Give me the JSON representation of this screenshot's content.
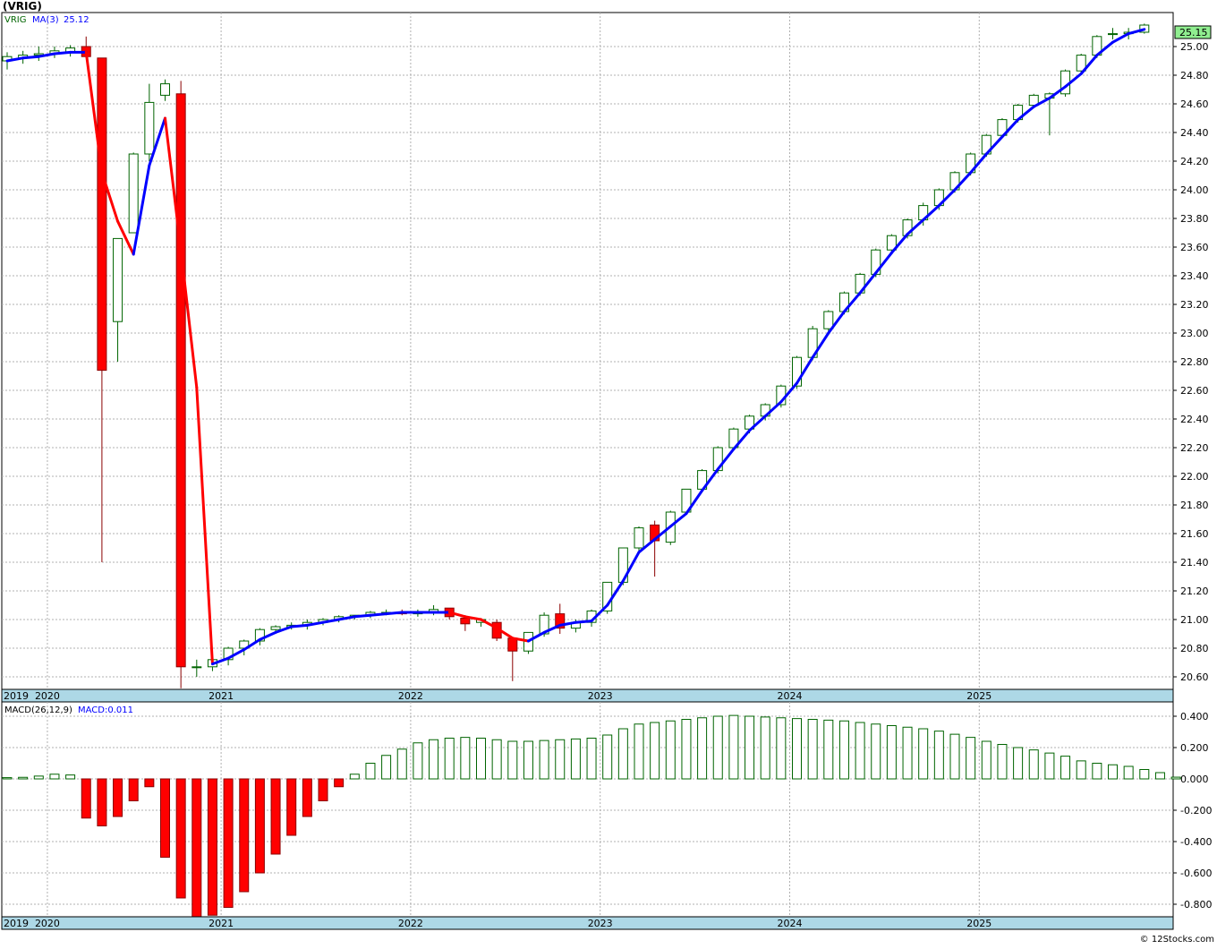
{
  "header": {
    "title": "(VRIG)",
    "price_legend_ticker": "VRIG",
    "price_legend_ma": "MA(3)",
    "price_legend_ma_value": "25.12",
    "last_price_badge": "25.15",
    "macd_legend_name": "MACD(26,12,9)",
    "macd_legend_value": "MACD:0.011",
    "watermark": "© 12Stocks.com"
  },
  "colors": {
    "up_body": "#ffffff",
    "up_border": "#006400",
    "down_body": "#ff0000",
    "down_border": "#8b0000",
    "ma_rising": "#0000ff",
    "ma_falling": "#ff0000",
    "macd_pos": "#006400",
    "macd_neg": "#ff0000",
    "grid": "#b0b0b0",
    "axis_band": "#add8e6",
    "badge": "#90ee90"
  },
  "chart_data": [
    {
      "type": "candlestick",
      "title": "(VRIG)",
      "interval": "monthly",
      "x_labels": [
        "2019",
        "2020",
        "2021",
        "2022",
        "2023",
        "2024",
        "2025"
      ],
      "y_ticks": [
        "25.00",
        "24.80",
        "24.60",
        "24.40",
        "24.20",
        "24.00",
        "23.80",
        "23.60",
        "23.40",
        "23.20",
        "23.00",
        "22.80",
        "22.60",
        "22.40",
        "22.20",
        "22.00",
        "21.80",
        "21.60",
        "21.40",
        "21.20",
        "21.00",
        "20.80",
        "20.60"
      ],
      "ylim": [
        20.5,
        25.2
      ],
      "grid": true,
      "series": [
        {
          "name": "VRIG",
          "ohlc": [
            [
              24.9,
              24.96,
              24.84,
              24.93
            ],
            [
              24.92,
              24.97,
              24.88,
              24.94
            ],
            [
              24.94,
              25.0,
              24.9,
              24.95
            ],
            [
              24.95,
              25.0,
              24.92,
              24.97
            ],
            [
              24.96,
              25.01,
              24.93,
              24.99
            ],
            [
              25.0,
              25.07,
              24.92,
              24.93
            ],
            [
              24.92,
              24.92,
              21.4,
              22.74
            ],
            [
              23.08,
              23.66,
              22.8,
              23.66
            ],
            [
              23.7,
              24.26,
              23.7,
              24.25
            ],
            [
              24.25,
              24.74,
              24.2,
              24.61
            ],
            [
              24.66,
              24.77,
              24.62,
              24.74
            ],
            [
              24.67,
              24.76,
              20.52,
              20.67
            ],
            [
              20.67,
              20.72,
              20.6,
              20.67
            ],
            [
              20.67,
              20.72,
              20.64,
              20.72
            ],
            [
              20.72,
              20.81,
              20.68,
              20.8
            ],
            [
              20.8,
              20.86,
              20.75,
              20.85
            ],
            [
              20.85,
              20.94,
              20.82,
              20.93
            ],
            [
              20.93,
              20.96,
              20.91,
              20.95
            ],
            [
              20.95,
              20.98,
              20.93,
              20.96
            ],
            [
              20.96,
              21.0,
              20.93,
              20.98
            ],
            [
              20.98,
              21.01,
              20.96,
              21.0
            ],
            [
              21.0,
              21.03,
              20.98,
              21.02
            ],
            [
              21.02,
              21.03,
              21.0,
              21.03
            ],
            [
              21.03,
              21.06,
              21.01,
              21.05
            ],
            [
              21.05,
              21.07,
              21.03,
              21.05
            ],
            [
              21.05,
              21.07,
              21.03,
              21.04
            ],
            [
              21.04,
              21.07,
              21.02,
              21.05
            ],
            [
              21.05,
              21.1,
              21.03,
              21.07
            ],
            [
              21.08,
              21.08,
              21.0,
              21.02
            ],
            [
              21.01,
              21.03,
              20.92,
              20.97
            ],
            [
              20.98,
              21.01,
              20.95,
              21.0
            ],
            [
              20.98,
              21.0,
              20.85,
              20.87
            ],
            [
              20.87,
              20.88,
              20.57,
              20.78
            ],
            [
              20.78,
              20.89,
              20.76,
              20.91
            ],
            [
              20.9,
              21.05,
              20.88,
              21.03
            ],
            [
              21.04,
              21.11,
              20.9,
              20.94
            ],
            [
              20.94,
              21.0,
              20.91,
              20.98
            ],
            [
              20.98,
              21.07,
              20.95,
              21.06
            ],
            [
              21.06,
              21.26,
              21.04,
              21.26
            ],
            [
              21.26,
              21.5,
              21.24,
              21.5
            ],
            [
              21.5,
              21.65,
              21.47,
              21.64
            ],
            [
              21.66,
              21.69,
              21.3,
              21.55
            ],
            [
              21.54,
              21.76,
              21.52,
              21.75
            ],
            [
              21.75,
              21.91,
              21.73,
              21.91
            ],
            [
              21.91,
              22.05,
              21.89,
              22.04
            ],
            [
              22.04,
              22.21,
              22.02,
              22.2
            ],
            [
              22.2,
              22.34,
              22.18,
              22.33
            ],
            [
              22.33,
              22.43,
              22.3,
              22.42
            ],
            [
              22.42,
              22.51,
              22.39,
              22.5
            ],
            [
              22.5,
              22.64,
              22.48,
              22.63
            ],
            [
              22.63,
              22.84,
              22.61,
              22.83
            ],
            [
              22.83,
              23.05,
              22.81,
              23.03
            ],
            [
              23.03,
              23.16,
              23.01,
              23.15
            ],
            [
              23.15,
              23.29,
              23.13,
              23.28
            ],
            [
              23.28,
              23.42,
              23.26,
              23.41
            ],
            [
              23.41,
              23.59,
              23.39,
              23.58
            ],
            [
              23.58,
              23.69,
              23.56,
              23.68
            ],
            [
              23.68,
              23.8,
              23.66,
              23.79
            ],
            [
              23.79,
              23.91,
              23.75,
              23.89
            ],
            [
              23.89,
              24.01,
              23.86,
              24.0
            ],
            [
              24.0,
              24.13,
              23.98,
              24.12
            ],
            [
              24.12,
              24.26,
              24.1,
              24.25
            ],
            [
              24.25,
              24.39,
              24.23,
              24.38
            ],
            [
              24.38,
              24.5,
              24.36,
              24.49
            ],
            [
              24.49,
              24.6,
              24.47,
              24.59
            ],
            [
              24.59,
              24.67,
              24.57,
              24.66
            ],
            [
              24.64,
              24.68,
              24.38,
              24.67
            ],
            [
              24.67,
              24.84,
              24.65,
              24.83
            ],
            [
              24.83,
              24.95,
              24.81,
              24.94
            ],
            [
              24.94,
              25.08,
              24.92,
              25.07
            ],
            [
              25.09,
              25.13,
              25.05,
              25.09
            ],
            [
              25.09,
              25.13,
              25.05,
              25.1
            ],
            [
              25.1,
              25.16,
              25.09,
              25.15
            ]
          ]
        },
        {
          "name": "MA(3)",
          "values": [
            24.9,
            24.92,
            24.93,
            24.95,
            24.96,
            24.96,
            24.12,
            23.78,
            23.55,
            24.17,
            24.5,
            23.58,
            22.62,
            20.69,
            20.73,
            20.79,
            20.86,
            20.91,
            20.95,
            20.96,
            20.98,
            21.0,
            21.02,
            21.03,
            21.04,
            21.05,
            21.05,
            21.05,
            21.05,
            21.02,
            21.0,
            20.94,
            20.87,
            20.85,
            20.91,
            20.96,
            20.98,
            20.99,
            21.1,
            21.27,
            21.47,
            21.56,
            21.65,
            21.74,
            21.9,
            22.05,
            22.19,
            22.32,
            22.42,
            22.52,
            22.65,
            22.83,
            23.0,
            23.15,
            23.28,
            23.42,
            23.56,
            23.69,
            23.79,
            23.89,
            24.0,
            24.12,
            24.25,
            24.37,
            24.49,
            24.58,
            24.64,
            24.72,
            24.81,
            24.94,
            25.03,
            25.09,
            25.12
          ]
        }
      ]
    },
    {
      "type": "bar",
      "title": "MACD(26,12,9)",
      "x_labels": [
        "2019",
        "2020",
        "2021",
        "2022",
        "2023",
        "2024",
        "2025"
      ],
      "y_ticks": [
        "0.400",
        "0.200",
        "0.000",
        "-0.200",
        "-0.400",
        "-0.600",
        "-0.800"
      ],
      "ylim": [
        -0.88,
        0.44
      ],
      "grid": true,
      "series": [
        {
          "name": "MACD",
          "values": [
            0.008,
            0.01,
            0.018,
            0.03,
            0.025,
            -0.25,
            -0.3,
            -0.24,
            -0.14,
            -0.05,
            -0.5,
            -0.76,
            -0.88,
            -0.87,
            -0.82,
            -0.72,
            -0.6,
            -0.48,
            -0.36,
            -0.24,
            -0.14,
            -0.05,
            0.03,
            0.1,
            0.15,
            0.19,
            0.23,
            0.25,
            0.26,
            0.265,
            0.26,
            0.25,
            0.24,
            0.24,
            0.245,
            0.25,
            0.255,
            0.26,
            0.28,
            0.32,
            0.35,
            0.36,
            0.37,
            0.38,
            0.39,
            0.4,
            0.405,
            0.4,
            0.395,
            0.39,
            0.385,
            0.38,
            0.375,
            0.37,
            0.36,
            0.35,
            0.34,
            0.33,
            0.32,
            0.305,
            0.285,
            0.265,
            0.24,
            0.22,
            0.2,
            0.185,
            0.165,
            0.145,
            0.115,
            0.1,
            0.09,
            0.08,
            0.06,
            0.04,
            0.011
          ]
        }
      ]
    }
  ]
}
